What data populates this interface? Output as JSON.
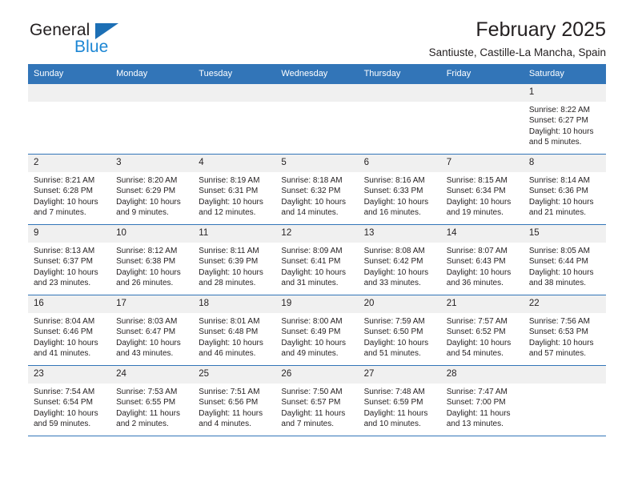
{
  "logo": {
    "word_one": "General",
    "word_two": "Blue",
    "triangle_color": "#1c6fb5",
    "blue_color": "#1c86d4"
  },
  "header": {
    "title": "February 2025",
    "subtitle": "Santiuste, Castille-La Mancha, Spain"
  },
  "theme": {
    "header_blue": "#3275b8",
    "daynum_band": "#f0f0f0",
    "text": "#231f20"
  },
  "weekdays": [
    "Sunday",
    "Monday",
    "Tuesday",
    "Wednesday",
    "Thursday",
    "Friday",
    "Saturday"
  ],
  "weeks": [
    [
      {
        "day": "",
        "empty": true
      },
      {
        "day": "",
        "empty": true
      },
      {
        "day": "",
        "empty": true
      },
      {
        "day": "",
        "empty": true
      },
      {
        "day": "",
        "empty": true
      },
      {
        "day": "",
        "empty": true
      },
      {
        "day": "1",
        "sunrise": "Sunrise: 8:22 AM",
        "sunset": "Sunset: 6:27 PM",
        "daylight": "Daylight: 10 hours and 5 minutes."
      }
    ],
    [
      {
        "day": "2",
        "sunrise": "Sunrise: 8:21 AM",
        "sunset": "Sunset: 6:28 PM",
        "daylight": "Daylight: 10 hours and 7 minutes."
      },
      {
        "day": "3",
        "sunrise": "Sunrise: 8:20 AM",
        "sunset": "Sunset: 6:29 PM",
        "daylight": "Daylight: 10 hours and 9 minutes."
      },
      {
        "day": "4",
        "sunrise": "Sunrise: 8:19 AM",
        "sunset": "Sunset: 6:31 PM",
        "daylight": "Daylight: 10 hours and 12 minutes."
      },
      {
        "day": "5",
        "sunrise": "Sunrise: 8:18 AM",
        "sunset": "Sunset: 6:32 PM",
        "daylight": "Daylight: 10 hours and 14 minutes."
      },
      {
        "day": "6",
        "sunrise": "Sunrise: 8:16 AM",
        "sunset": "Sunset: 6:33 PM",
        "daylight": "Daylight: 10 hours and 16 minutes."
      },
      {
        "day": "7",
        "sunrise": "Sunrise: 8:15 AM",
        "sunset": "Sunset: 6:34 PM",
        "daylight": "Daylight: 10 hours and 19 minutes."
      },
      {
        "day": "8",
        "sunrise": "Sunrise: 8:14 AM",
        "sunset": "Sunset: 6:36 PM",
        "daylight": "Daylight: 10 hours and 21 minutes."
      }
    ],
    [
      {
        "day": "9",
        "sunrise": "Sunrise: 8:13 AM",
        "sunset": "Sunset: 6:37 PM",
        "daylight": "Daylight: 10 hours and 23 minutes."
      },
      {
        "day": "10",
        "sunrise": "Sunrise: 8:12 AM",
        "sunset": "Sunset: 6:38 PM",
        "daylight": "Daylight: 10 hours and 26 minutes."
      },
      {
        "day": "11",
        "sunrise": "Sunrise: 8:11 AM",
        "sunset": "Sunset: 6:39 PM",
        "daylight": "Daylight: 10 hours and 28 minutes."
      },
      {
        "day": "12",
        "sunrise": "Sunrise: 8:09 AM",
        "sunset": "Sunset: 6:41 PM",
        "daylight": "Daylight: 10 hours and 31 minutes."
      },
      {
        "day": "13",
        "sunrise": "Sunrise: 8:08 AM",
        "sunset": "Sunset: 6:42 PM",
        "daylight": "Daylight: 10 hours and 33 minutes."
      },
      {
        "day": "14",
        "sunrise": "Sunrise: 8:07 AM",
        "sunset": "Sunset: 6:43 PM",
        "daylight": "Daylight: 10 hours and 36 minutes."
      },
      {
        "day": "15",
        "sunrise": "Sunrise: 8:05 AM",
        "sunset": "Sunset: 6:44 PM",
        "daylight": "Daylight: 10 hours and 38 minutes."
      }
    ],
    [
      {
        "day": "16",
        "sunrise": "Sunrise: 8:04 AM",
        "sunset": "Sunset: 6:46 PM",
        "daylight": "Daylight: 10 hours and 41 minutes."
      },
      {
        "day": "17",
        "sunrise": "Sunrise: 8:03 AM",
        "sunset": "Sunset: 6:47 PM",
        "daylight": "Daylight: 10 hours and 43 minutes."
      },
      {
        "day": "18",
        "sunrise": "Sunrise: 8:01 AM",
        "sunset": "Sunset: 6:48 PM",
        "daylight": "Daylight: 10 hours and 46 minutes."
      },
      {
        "day": "19",
        "sunrise": "Sunrise: 8:00 AM",
        "sunset": "Sunset: 6:49 PM",
        "daylight": "Daylight: 10 hours and 49 minutes."
      },
      {
        "day": "20",
        "sunrise": "Sunrise: 7:59 AM",
        "sunset": "Sunset: 6:50 PM",
        "daylight": "Daylight: 10 hours and 51 minutes."
      },
      {
        "day": "21",
        "sunrise": "Sunrise: 7:57 AM",
        "sunset": "Sunset: 6:52 PM",
        "daylight": "Daylight: 10 hours and 54 minutes."
      },
      {
        "day": "22",
        "sunrise": "Sunrise: 7:56 AM",
        "sunset": "Sunset: 6:53 PM",
        "daylight": "Daylight: 10 hours and 57 minutes."
      }
    ],
    [
      {
        "day": "23",
        "sunrise": "Sunrise: 7:54 AM",
        "sunset": "Sunset: 6:54 PM",
        "daylight": "Daylight: 10 hours and 59 minutes."
      },
      {
        "day": "24",
        "sunrise": "Sunrise: 7:53 AM",
        "sunset": "Sunset: 6:55 PM",
        "daylight": "Daylight: 11 hours and 2 minutes."
      },
      {
        "day": "25",
        "sunrise": "Sunrise: 7:51 AM",
        "sunset": "Sunset: 6:56 PM",
        "daylight": "Daylight: 11 hours and 4 minutes."
      },
      {
        "day": "26",
        "sunrise": "Sunrise: 7:50 AM",
        "sunset": "Sunset: 6:57 PM",
        "daylight": "Daylight: 11 hours and 7 minutes."
      },
      {
        "day": "27",
        "sunrise": "Sunrise: 7:48 AM",
        "sunset": "Sunset: 6:59 PM",
        "daylight": "Daylight: 11 hours and 10 minutes."
      },
      {
        "day": "28",
        "sunrise": "Sunrise: 7:47 AM",
        "sunset": "Sunset: 7:00 PM",
        "daylight": "Daylight: 11 hours and 13 minutes."
      },
      {
        "day": "",
        "empty": true
      }
    ]
  ]
}
